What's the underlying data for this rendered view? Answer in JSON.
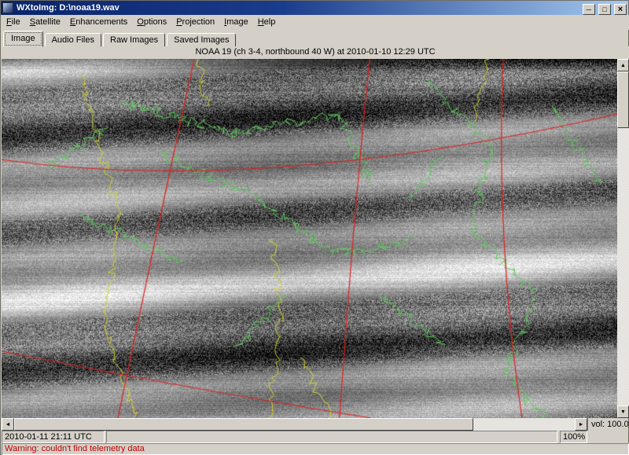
{
  "window": {
    "title": "WXtoImg: D:\\noaa19.wav",
    "icons": {
      "minimize": "─",
      "maximize": "□",
      "close": "×",
      "scroll_up": "▲",
      "scroll_down": "▼",
      "scroll_left": "◄",
      "scroll_right": "►"
    }
  },
  "menu": {
    "items": [
      {
        "label": "File"
      },
      {
        "label": "Satellite"
      },
      {
        "label": "Enhancements"
      },
      {
        "label": "Options"
      },
      {
        "label": "Projection"
      },
      {
        "label": "Image"
      },
      {
        "label": "Help"
      }
    ]
  },
  "tabs": {
    "active": "Image",
    "items": [
      {
        "label": "Image"
      },
      {
        "label": "Audio Files"
      },
      {
        "label": "Raw Images"
      },
      {
        "label": "Saved Images"
      }
    ]
  },
  "caption": "NOAA 19 (ch 3-4, northbound 40 W) at 2010-01-10 12:29 UTC",
  "statusbar": {
    "datetime": "2010-01-11 21:11 UTC",
    "volume": "vol: 100.0",
    "zoom": "100%"
  },
  "warning": "Warning: couldn't find telemetry data",
  "overlay_colors": {
    "coastline": "#5ecb5e",
    "boundaries": "#d2d22e",
    "graticule": "#e02020"
  }
}
